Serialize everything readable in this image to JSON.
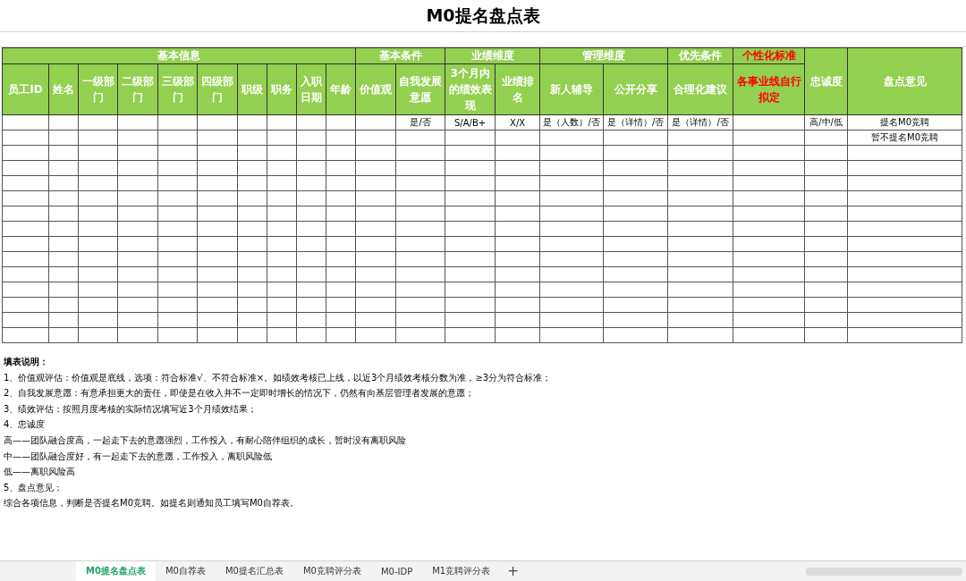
{
  "title": "M0提名盘点表",
  "header_groups": [
    {
      "kind": "group",
      "label": "基本信息",
      "emphasis": false,
      "columns": [
        {
          "label": "员工ID",
          "emphasis": false
        },
        {
          "label": "姓名",
          "emphasis": false
        },
        {
          "label": "一级部门",
          "emphasis": false
        },
        {
          "label": "二级部门",
          "emphasis": false
        },
        {
          "label": "三级部门",
          "emphasis": false
        },
        {
          "label": "四级部门",
          "emphasis": false
        },
        {
          "label": "职级",
          "emphasis": false
        },
        {
          "label": "职务",
          "emphasis": false
        },
        {
          "label": "入职日期",
          "emphasis": false
        },
        {
          "label": "年龄",
          "emphasis": false
        }
      ]
    },
    {
      "kind": "group",
      "label": "基本条件",
      "emphasis": false,
      "columns": [
        {
          "label": "价值观",
          "emphasis": false
        },
        {
          "label": "自我发展意愿",
          "emphasis": false,
          "samples": [
            "是/否"
          ]
        }
      ]
    },
    {
      "kind": "group",
      "label": "业绩维度",
      "emphasis": false,
      "columns": [
        {
          "label": "3个月内的绩效表现",
          "emphasis": false,
          "samples": [
            "S/A/B+"
          ]
        },
        {
          "label": "业绩排名",
          "emphasis": false,
          "samples": [
            "X/X"
          ]
        }
      ]
    },
    {
      "kind": "group",
      "label": "管理维度",
      "emphasis": false,
      "columns": [
        {
          "label": "新人辅导",
          "emphasis": false,
          "samples": [
            "是（人数）/否"
          ]
        },
        {
          "label": "公开分享",
          "emphasis": false,
          "samples": [
            "是（详情）/否"
          ]
        }
      ]
    },
    {
      "kind": "group",
      "label": "优先条件",
      "emphasis": false,
      "columns": [
        {
          "label": "合理化建议",
          "emphasis": false,
          "samples": [
            "是（详情）/否"
          ]
        }
      ]
    },
    {
      "kind": "group",
      "label": "个性化标准",
      "emphasis": true,
      "columns": [
        {
          "label": "各事业线自行拟定",
          "emphasis": true
        }
      ]
    },
    {
      "kind": "tall",
      "label": "忠诚度",
      "emphasis": false,
      "samples": [
        "高/中/低"
      ]
    },
    {
      "kind": "tall",
      "label": "盘点意见",
      "emphasis": false,
      "samples": [
        "提名M0竞聘",
        "暂不提名M0竞聘"
      ]
    }
  ],
  "notes": {
    "title": "填表说明：",
    "lines": [
      "1、价值观评估：价值观是底线，选项：符合标准√、不符合标准×。如绩效考核已上线，以近3个月绩效考核分数为准，≥3分为符合标准；",
      "2、自我发展意愿：有意承担更大的责任，即使是在收入并不一定即时增长的情况下，仍然有向基层管理者发展的意愿；",
      "3、绩效评估：按照月度考核的实际情况填写近3个月绩效结果；",
      "4、忠诚度",
      "高——团队融合度高，一起走下去的意愿强烈，工作投入，有耐心陪伴组织的成长，暂时没有离职风险",
      "中——团队融合度好，有一起走下去的意愿，工作投入，离职风险低",
      "低——离职风险高",
      "5、盘点意见：",
      "综合各项信息，判断是否提名M0竞聘。如提名则通知员工填写M0自荐表。"
    ]
  },
  "sheet_tabs": [
    {
      "label": "M0提名盘点表",
      "selected": true
    },
    {
      "label": "M0自荐表",
      "selected": false
    },
    {
      "label": "M0提名汇总表",
      "selected": false
    },
    {
      "label": "M0竞聘评分表",
      "selected": false
    },
    {
      "label": "M0-IDP",
      "selected": false
    },
    {
      "label": "M1竞聘评分表",
      "selected": false
    }
  ],
  "add_sheet": "+"
}
